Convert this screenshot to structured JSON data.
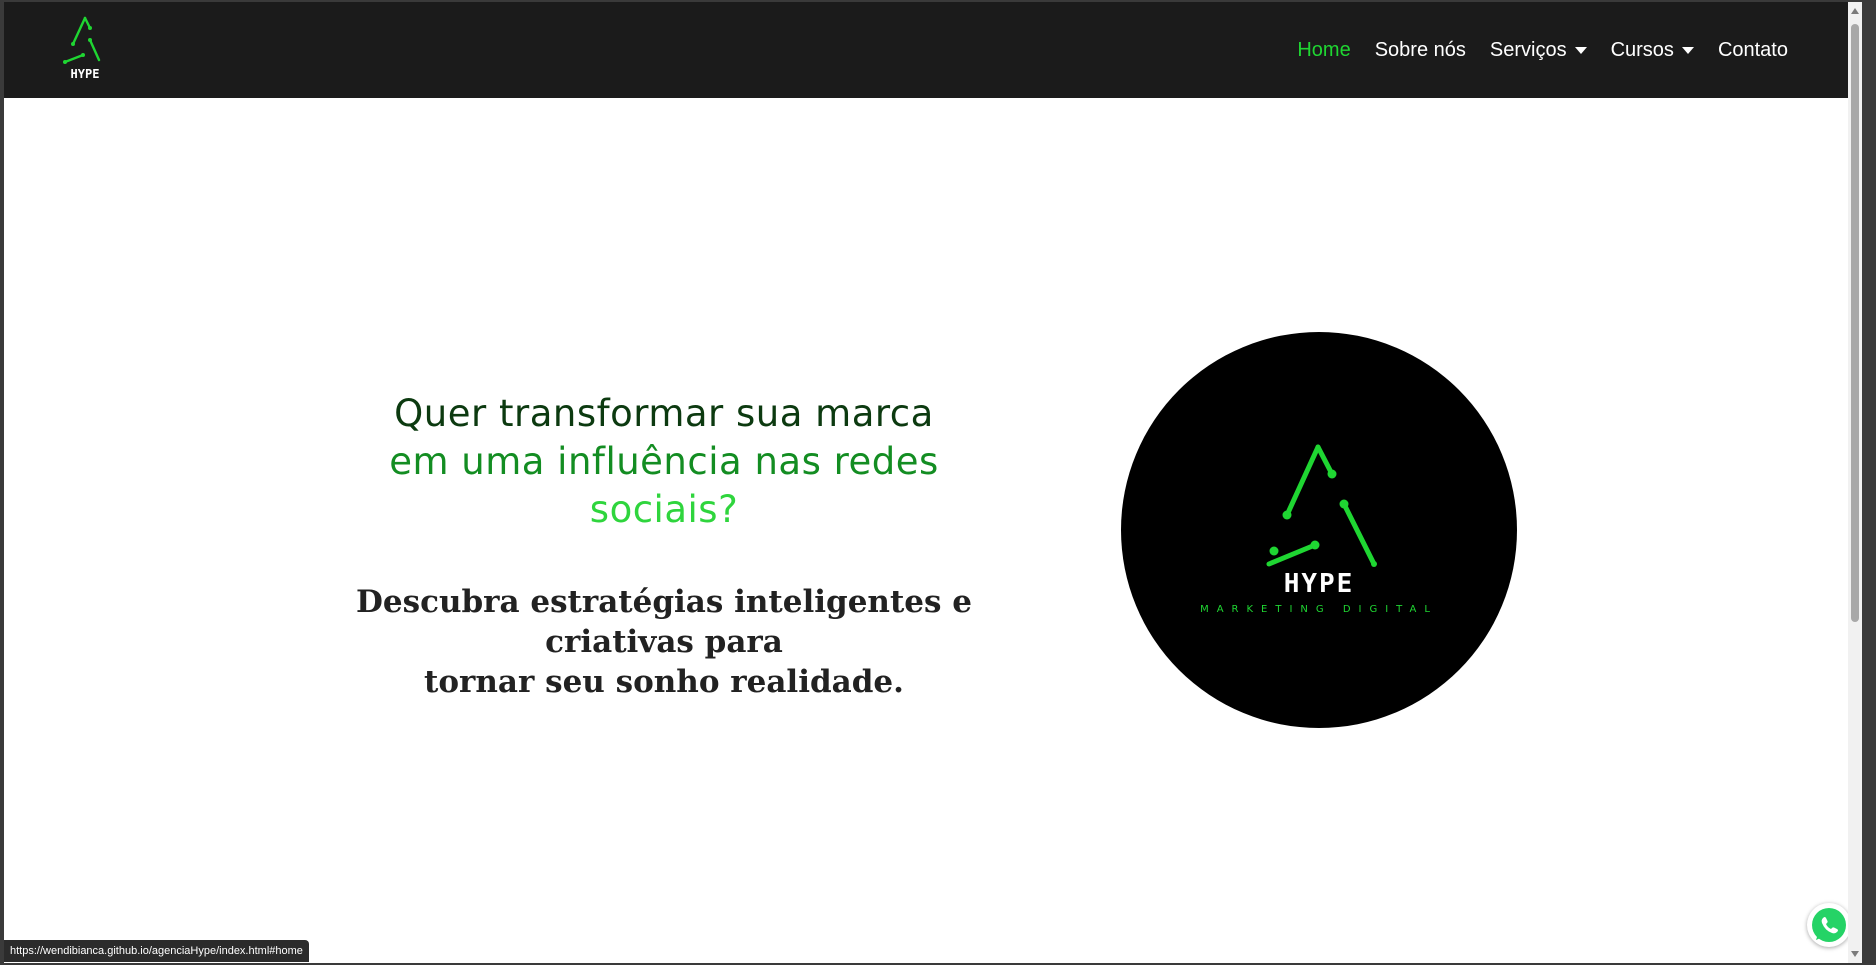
{
  "browser": {
    "status_url": "https://wendibianca.github.io/agenciaHype/index.html#home"
  },
  "navbar": {
    "logo_text": "HYPE",
    "items": [
      {
        "label": "Home",
        "active": true,
        "dropdown": false
      },
      {
        "label": "Sobre nós",
        "active": false,
        "dropdown": false
      },
      {
        "label": "Serviços",
        "active": false,
        "dropdown": true
      },
      {
        "label": "Cursos",
        "active": false,
        "dropdown": true
      },
      {
        "label": "Contato",
        "active": false,
        "dropdown": false
      }
    ]
  },
  "hero": {
    "title_line1": "Quer transformar sua marca",
    "title_line2": "em uma influência nas redes",
    "title_line3": "sociais?",
    "subtitle_line1": "Descubra estratégias inteligentes e criativas para",
    "subtitle_line2": "tornar seu sonho realidade."
  },
  "brand_logo": {
    "name": "HYPE",
    "tagline": "MARKETING DIGITAL"
  },
  "icons": [
    "hype-logo-icon",
    "caret-down-icon",
    "whatsapp-icon"
  ],
  "colors": {
    "nav_background": "#1b1b1b",
    "accent_green": "#1fd632",
    "title_dark_green": "#0c3a10",
    "title_mid_green": "#138d22",
    "title_bright_green": "#2fd53d",
    "whatsapp_green": "#25d366"
  }
}
